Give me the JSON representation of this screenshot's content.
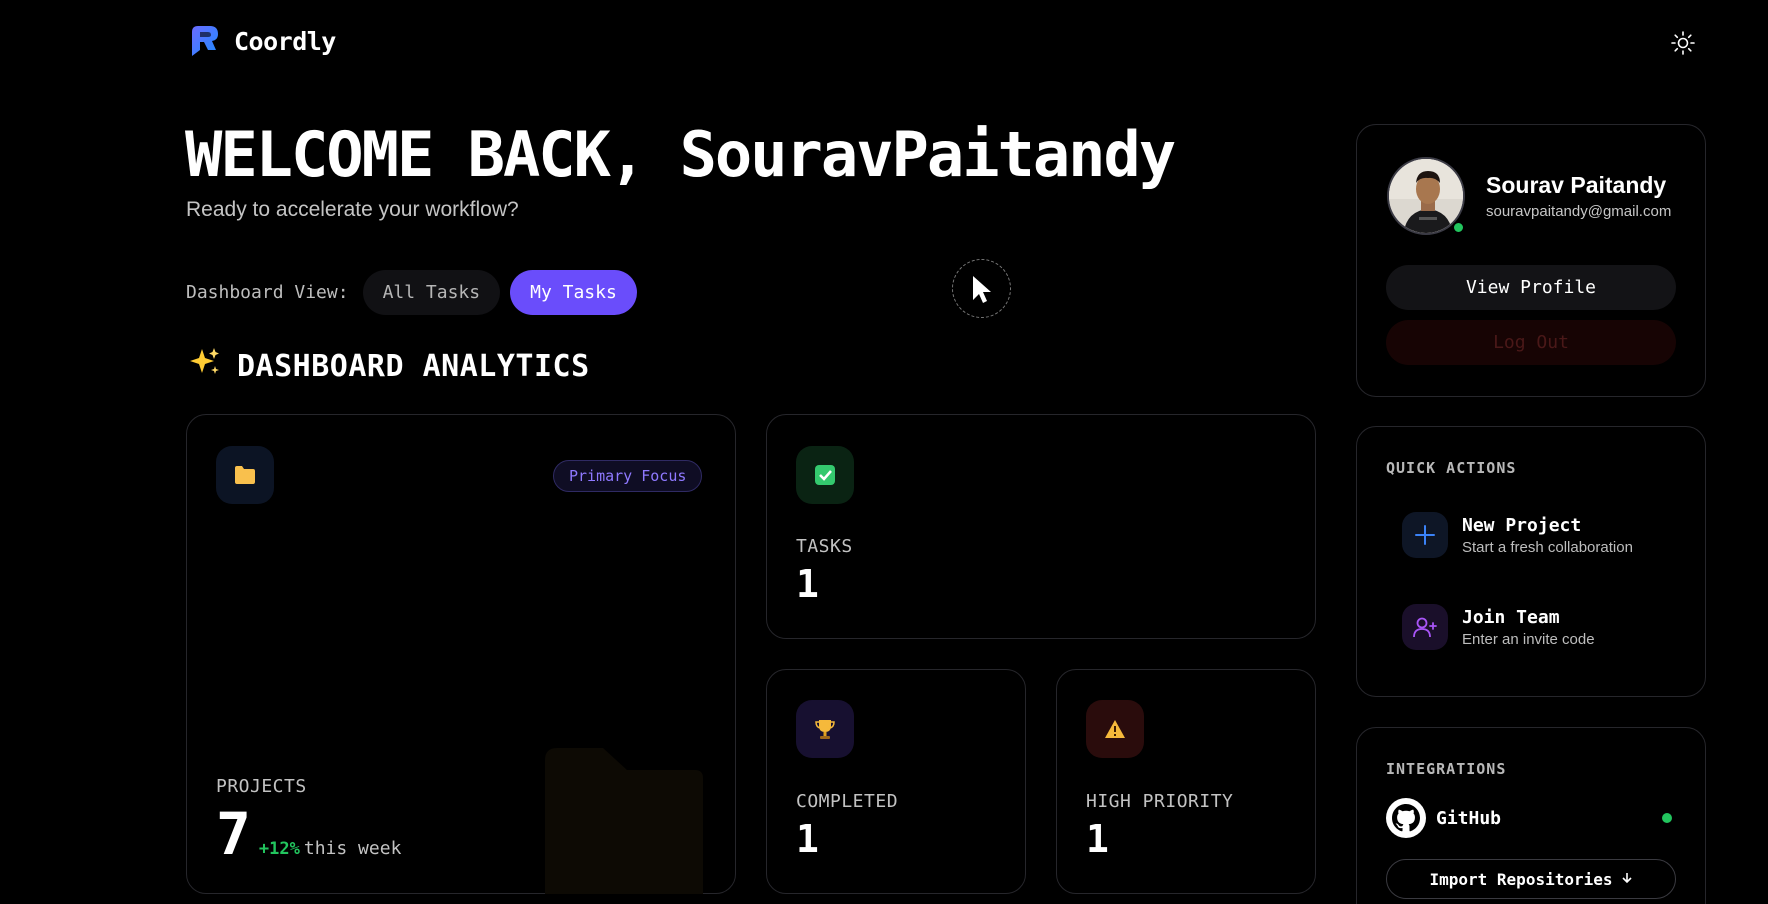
{
  "app": {
    "name": "Coordly"
  },
  "header": {
    "theme_icon": "sun-icon"
  },
  "welcome": {
    "title": "WELCOME BACK, SouravPaitandy",
    "subtitle": "Ready to accelerate your workflow?"
  },
  "view_toggle": {
    "label": "Dashboard View:",
    "options": [
      "All Tasks",
      "My Tasks"
    ],
    "selected": "My Tasks"
  },
  "analytics": {
    "title": "DASHBOARD ANALYTICS",
    "title_icon": "sparkles-icon",
    "projects": {
      "label": "PROJECTS",
      "value": "7",
      "change": "+12%",
      "change_suffix": "this week",
      "badge": "Primary Focus",
      "icon": "folder-icon"
    },
    "tasks": {
      "label": "TASKS",
      "value": "1",
      "icon": "check-icon"
    },
    "completed": {
      "label": "COMPLETED",
      "value": "1",
      "icon": "trophy-icon"
    },
    "high_priority": {
      "label": "HIGH PRIORITY",
      "value": "1",
      "icon": "warning-icon"
    }
  },
  "profile": {
    "name": "Sourav Paitandy",
    "email": "souravpaitandy@gmail.com",
    "view_profile": "View Profile",
    "log_out": "Log Out",
    "status": "online"
  },
  "quick_actions": {
    "heading": "QUICK ACTIONS",
    "items": [
      {
        "title": "New Project",
        "subtitle": "Start a fresh collaboration",
        "icon": "plus-icon"
      },
      {
        "title": "Join Team",
        "subtitle": "Enter an invite code",
        "icon": "user-plus-icon"
      }
    ]
  },
  "integrations": {
    "heading": "INTEGRATIONS",
    "github": {
      "name": "GitHub",
      "status": "connected"
    },
    "import_button": "Import Repositories"
  },
  "colors": {
    "accent": "#6a4dfb",
    "success": "#22c55e",
    "background": "#000000"
  }
}
